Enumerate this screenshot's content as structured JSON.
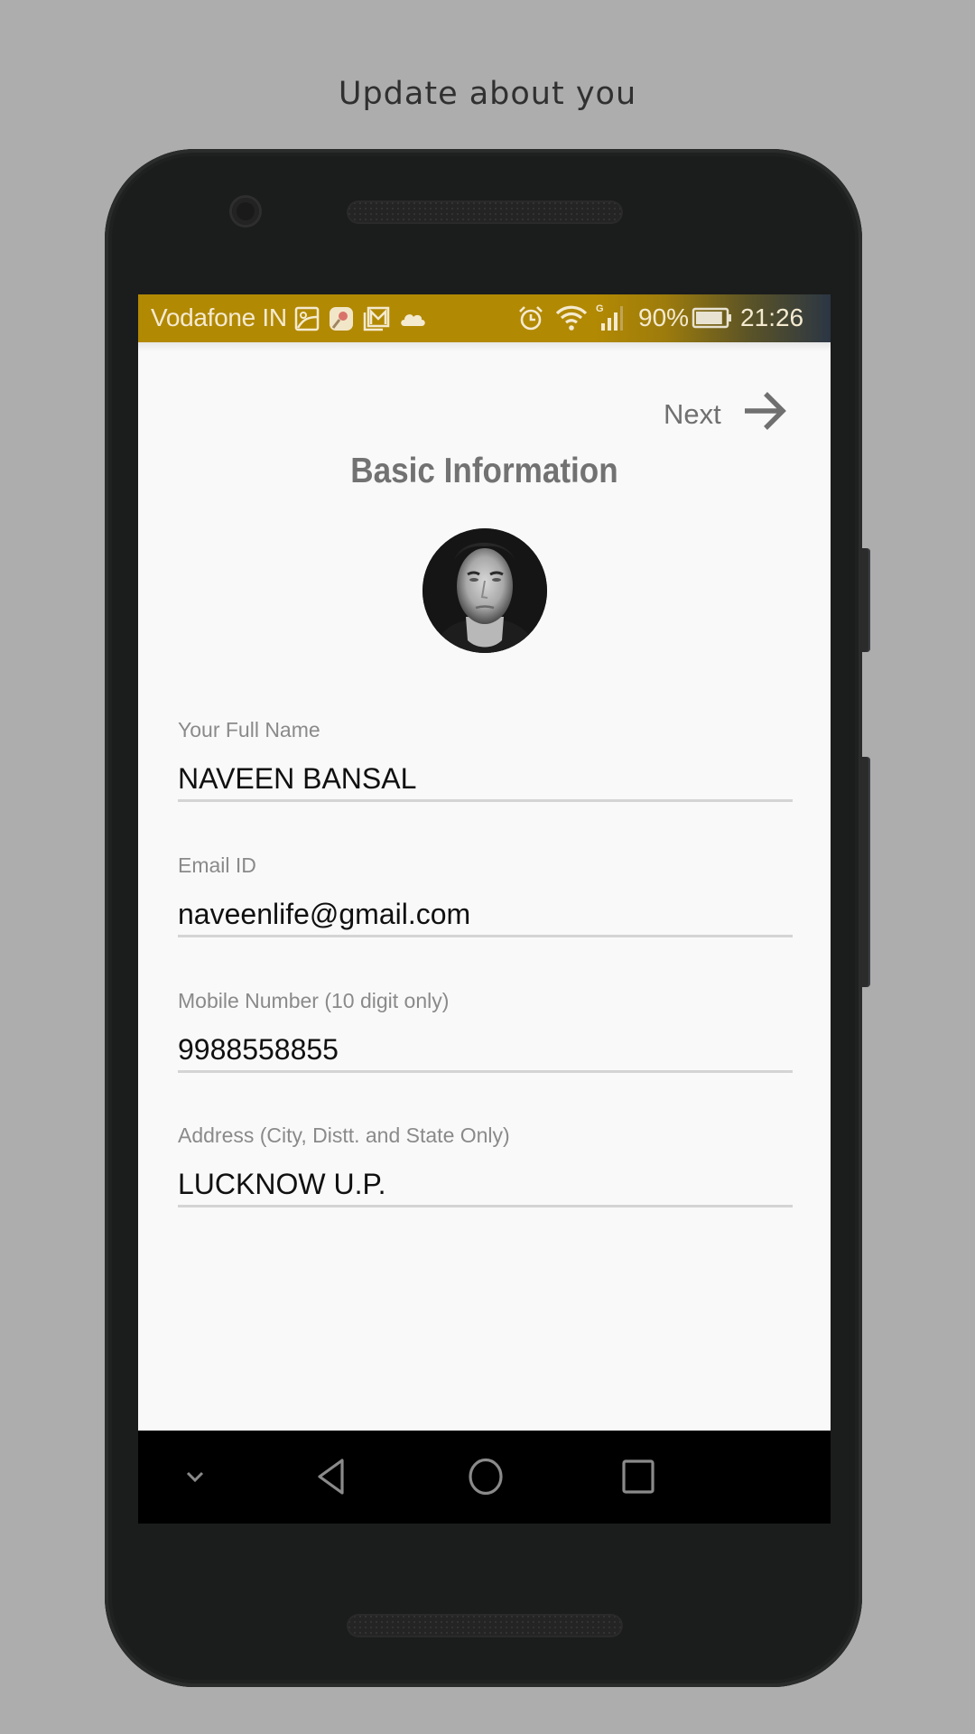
{
  "caption": "Update about you",
  "status_bar": {
    "carrier": "Vodafone IN",
    "left_icons": [
      "gallery-icon",
      "maps-icon",
      "gmail-icon",
      "cloud-icon"
    ],
    "right_icons": [
      "alarm-icon",
      "wifi-icon",
      "signal-icon"
    ],
    "network_type": "G",
    "battery_percent": "90%",
    "battery_level": 0.9,
    "time": "21:26",
    "background_color": "#b28903"
  },
  "header": {
    "next_label": "Next",
    "next_icon": "arrow-right-icon",
    "section_title": "Basic Information"
  },
  "profile": {
    "avatar": "profile-photo"
  },
  "form": {
    "fields": [
      {
        "label": "Your Full Name",
        "value": "NAVEEN BANSAL"
      },
      {
        "label": "Email ID",
        "value": "naveenlife@gmail.com"
      },
      {
        "label": "Mobile Number (10 digit only)",
        "value": "9988558855"
      },
      {
        "label": "Address (City, Distt. and State Only)",
        "value": "LUCKNOW U.P."
      }
    ]
  },
  "nav_bar": {
    "buttons": [
      "hide-keyboard-icon",
      "back-icon",
      "home-icon",
      "recents-icon"
    ]
  }
}
